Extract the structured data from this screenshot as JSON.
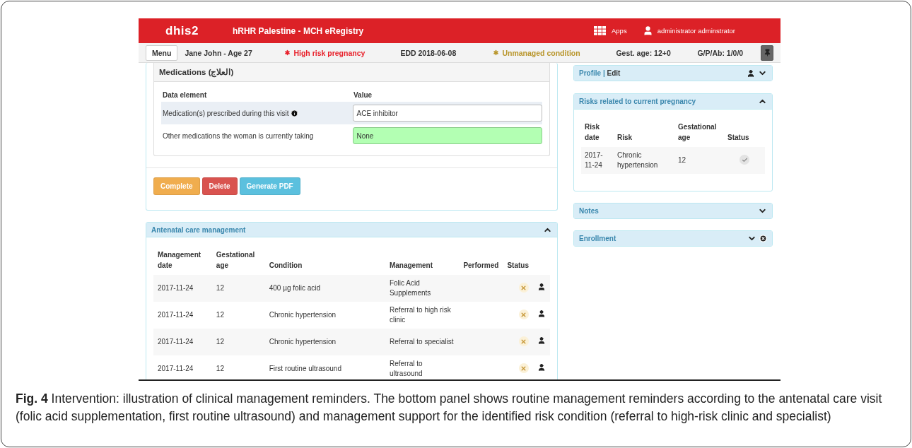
{
  "topbar": {
    "logo": "dhis2",
    "title": "hRHR Palestine - MCH eRegistry",
    "apps": "Apps",
    "user": "administrator adminstrator"
  },
  "infobar": {
    "menu": "Menu",
    "items": [
      {
        "kind": "text",
        "label": "Jane John - Age 27"
      },
      {
        "kind": "alert",
        "label": "High risk pregnancy",
        "color": "#e8202a"
      },
      {
        "kind": "text",
        "label": "EDD 2018-06-08"
      },
      {
        "kind": "alert",
        "label": "Unmanaged condition",
        "color": "#b8952a"
      },
      {
        "kind": "text",
        "label": "Gest. age: 12+0"
      },
      {
        "kind": "text",
        "label": "G/P/Ab: 1/0/0"
      }
    ]
  },
  "medications": {
    "title": "Medications (العلاج)",
    "columns": [
      "Data element",
      "Value"
    ],
    "rows": [
      {
        "label": "Medication(s) prescribed during this visit",
        "info": true,
        "value": "ACE inhibitor",
        "highlighted": false
      },
      {
        "label": "Other medications the woman is currently taking",
        "info": false,
        "value": "None",
        "highlighted": true
      }
    ]
  },
  "buttons": [
    {
      "label": "Complete",
      "kind": "warning"
    },
    {
      "label": "Delete",
      "kind": "danger"
    },
    {
      "label": "Generate PDF",
      "kind": "info"
    }
  ],
  "antenatal": {
    "title": "Antenatal care management",
    "expanded": true,
    "columns": [
      "Management date",
      "Gestational age",
      "Condition",
      "Management",
      "Performed",
      "Status"
    ],
    "rows": [
      {
        "date": "2017-11-24",
        "gest": "12",
        "condition": "400 µg folic acid",
        "management": "Folic Acid Supplements",
        "done": false
      },
      {
        "date": "2017-11-24",
        "gest": "12",
        "condition": "Chronic hypertension",
        "management": "Referral to high risk clinic",
        "done": false
      },
      {
        "date": "2017-11-24",
        "gest": "12",
        "condition": "Chronic hypertension",
        "management": "Referral to specialist",
        "done": false
      },
      {
        "date": "2017-11-24",
        "gest": "12",
        "condition": "First routine ultrasound",
        "management": "Referral to ultrasound",
        "done": false
      }
    ]
  },
  "sidebar": {
    "profile": {
      "label": "Profile",
      "separator": "|",
      "action": "Edit",
      "expanded": false
    },
    "risks": {
      "title": "Risks related to current pregnancy",
      "expanded": true,
      "columns": [
        "Risk date",
        "Risk",
        "Gestational age",
        "Status"
      ],
      "rows": [
        {
          "date": "2017-11-24",
          "risk": "Chronic hypertension",
          "gest": "12",
          "done": true
        }
      ]
    },
    "notes": {
      "title": "Notes",
      "expanded": false
    },
    "enrollment": {
      "title": "Enrollment",
      "expanded": false
    }
  },
  "caption": "**Fig. 4** Intervention: illustration of clinical management reminders. The bottom panel shows routine management reminders according to the antenatal care visit (folic acid supplementation, first routine ultrasound) and management support for the identified risk condition (referral to high-risk clinic and specialist)"
}
